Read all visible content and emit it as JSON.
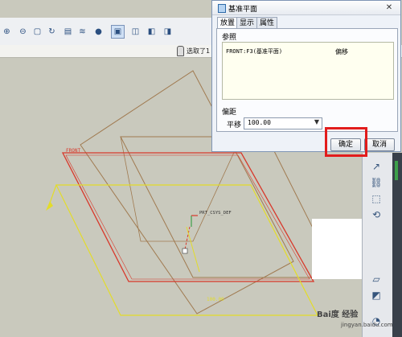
{
  "toolbar": {
    "icons": [
      "zoom-in-icon",
      "zoom-out-icon",
      "refit-icon",
      "reorient-icon",
      "view-manager-icon",
      "layers-icon",
      "display-style-icon",
      "saved-views-icon",
      "datum-plane-icon",
      "datum-axis-icon",
      "datum-point-icon"
    ],
    "selection_text": "选取了1"
  },
  "dialog": {
    "title": "基准平面",
    "tabs": [
      "放置",
      "显示",
      "属性"
    ],
    "references_label": "参照",
    "reference": {
      "name": "FRONT:F3(基准平面)",
      "type": "偏移"
    },
    "offset_section_label": "偏距",
    "translate_label": "平移",
    "offset_value": "100.00",
    "ok_label": "确定",
    "cancel_label": "取消"
  },
  "viewport": {
    "plane_label": "FRONT",
    "csys_label": "PRT_CSYS_DEF",
    "dimension_label": "100.00"
  },
  "watermark": {
    "text": "Bai度 经验",
    "sub": "jingyan.baidu.com"
  }
}
